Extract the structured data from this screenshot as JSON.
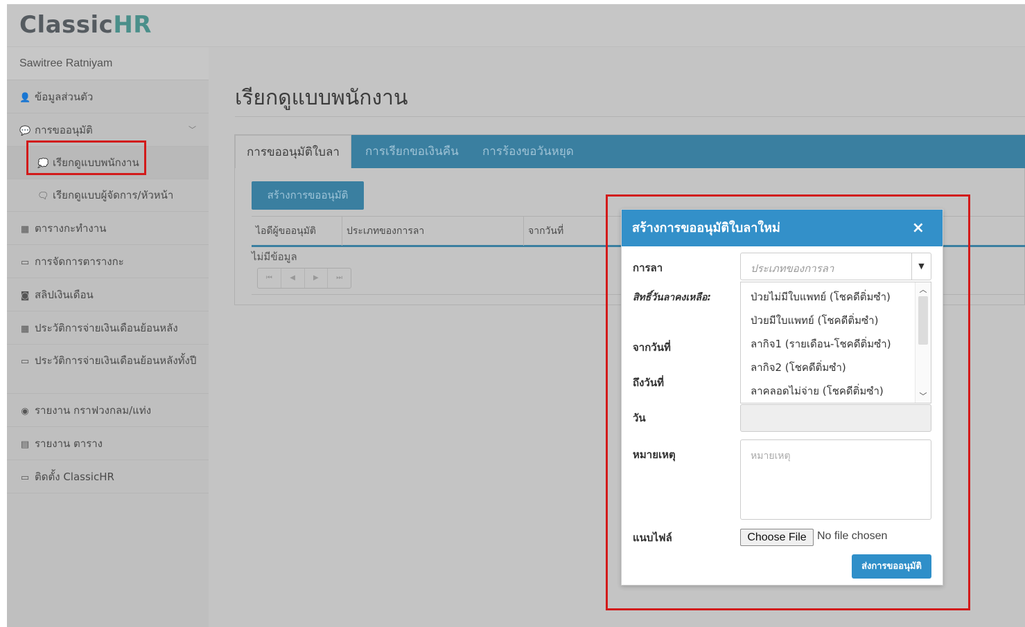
{
  "app": {
    "logo_classic": "Classic",
    "logo_hr": "HR"
  },
  "sidebar": {
    "user": "Sawitree Ratniyam",
    "items": [
      {
        "icon": "user-icon",
        "glyph": "👤",
        "label": "ข้อมูลส่วนตัว"
      },
      {
        "icon": "comment-icon",
        "glyph": "💬",
        "label": "การขออนุมัติ"
      },
      {
        "icon": "chat-bubble-icon",
        "glyph": "💭",
        "label": "เรียกดูแบบพนักงาน"
      },
      {
        "icon": "chat-bubbles-icon",
        "glyph": "🗨",
        "label": "เรียกดูแบบผู้จัดการ/หัวหน้า"
      },
      {
        "icon": "calendar-icon",
        "glyph": "▦",
        "label": "ตารางกะทำงาน"
      },
      {
        "icon": "calendar-outline-icon",
        "glyph": "▭",
        "label": "การจัดการตารางกะ"
      },
      {
        "icon": "money-icon",
        "glyph": "◙",
        "label": "สลิปเงินเดือน"
      },
      {
        "icon": "calendar-icon",
        "glyph": "▦",
        "label": "ประวัติการจ่ายเงินเดือนย้อนหลัง"
      },
      {
        "icon": "calendar-outline-icon",
        "glyph": "▭",
        "label": "ประวัติการจ่ายเงินเดือนย้อนหลังทั้งปี"
      },
      {
        "icon": "target-icon",
        "glyph": "◉",
        "label": "รายงาน กราฟวงกลม/แท่ง"
      },
      {
        "icon": "file-chart-icon",
        "glyph": "▤",
        "label": "รายงาน ตาราง"
      },
      {
        "icon": "monitor-icon",
        "glyph": "▭",
        "label": "ติดตั้ง ClassicHR"
      }
    ]
  },
  "main": {
    "title": "เรียกดูแบบพนักงาน",
    "tabs": [
      "การขออนุมัติใบลา",
      "การเรียกขอเงินคืน",
      "การร้องขอวันหยุด"
    ],
    "create_button": "สร้างการขออนุมัติ",
    "columns": [
      "ไอดีผู้ขออนุมัติ",
      "ประเภทของการลา",
      "จากวันที่"
    ],
    "no_data": "ไม่มีข้อมูล",
    "pager": [
      "⏮",
      "◀",
      "▶",
      "⏭"
    ]
  },
  "modal": {
    "title": "สร้างการขออนุมัติใบลาใหม่",
    "close": "×",
    "labels": {
      "leave": "การลา",
      "balance": "สิทธิ์วันลาคงเหลือ:",
      "from": "จากวันที่",
      "to": "ถึงวันที่",
      "days": "วัน",
      "note": "หมายเหตุ",
      "attach": "แนบไฟล์"
    },
    "select_placeholder": "ประเภทของการลา",
    "options": [
      "ป่วยไม่มีใบแพทย์ (โชคดีติ่มซำ)",
      "ป่วยมีใบแพทย์ (โชคดีติ่มซำ)",
      "ลากิจ1 (รายเดือน-โชคดีติ่มซำ)",
      "ลากิจ2 (โชคดีติ่มซำ)",
      "ลาคลอดไม่จ่าย (โชคดีติ่มซำ)"
    ],
    "note_placeholder": "หมายเหตุ",
    "choose_file": "Choose File",
    "no_file": "No file chosen",
    "submit": "ส่งการขออนุมัติ"
  }
}
